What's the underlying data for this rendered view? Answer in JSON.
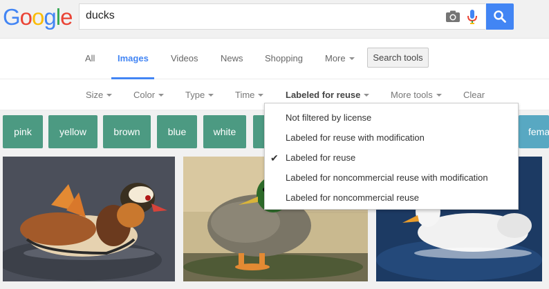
{
  "logo": {
    "letters": [
      "G",
      "o",
      "o",
      "g",
      "l",
      "e"
    ],
    "colors": [
      "#4285f4",
      "#ea4335",
      "#fbbc05",
      "#4285f4",
      "#34a853",
      "#ea4335"
    ]
  },
  "search": {
    "query": "ducks"
  },
  "tabs": [
    {
      "label": "All"
    },
    {
      "label": "Images"
    },
    {
      "label": "Videos"
    },
    {
      "label": "News"
    },
    {
      "label": "Shopping"
    },
    {
      "label": "More"
    }
  ],
  "search_tools_label": "Search tools",
  "tools": [
    {
      "label": "Size"
    },
    {
      "label": "Color"
    },
    {
      "label": "Type"
    },
    {
      "label": "Time"
    },
    {
      "label": "Labeled for reuse"
    },
    {
      "label": "More tools"
    },
    {
      "label": "Clear"
    }
  ],
  "chips": [
    {
      "label": "pink"
    },
    {
      "label": "yellow"
    },
    {
      "label": "brown"
    },
    {
      "label": "blue"
    },
    {
      "label": "white"
    },
    {
      "label": "fema"
    }
  ],
  "license_menu": {
    "items": [
      {
        "label": "Not filtered by license"
      },
      {
        "label": "Labeled for reuse with modification"
      },
      {
        "label": "Labeled for reuse"
      },
      {
        "label": "Labeled for noncommercial reuse with modification"
      },
      {
        "label": "Labeled for noncommercial reuse"
      }
    ],
    "checkmark": "✔"
  },
  "colors": {
    "accent": "#4285f4",
    "chip": "#4c9a82",
    "chip_alt": "#58a8c2"
  }
}
